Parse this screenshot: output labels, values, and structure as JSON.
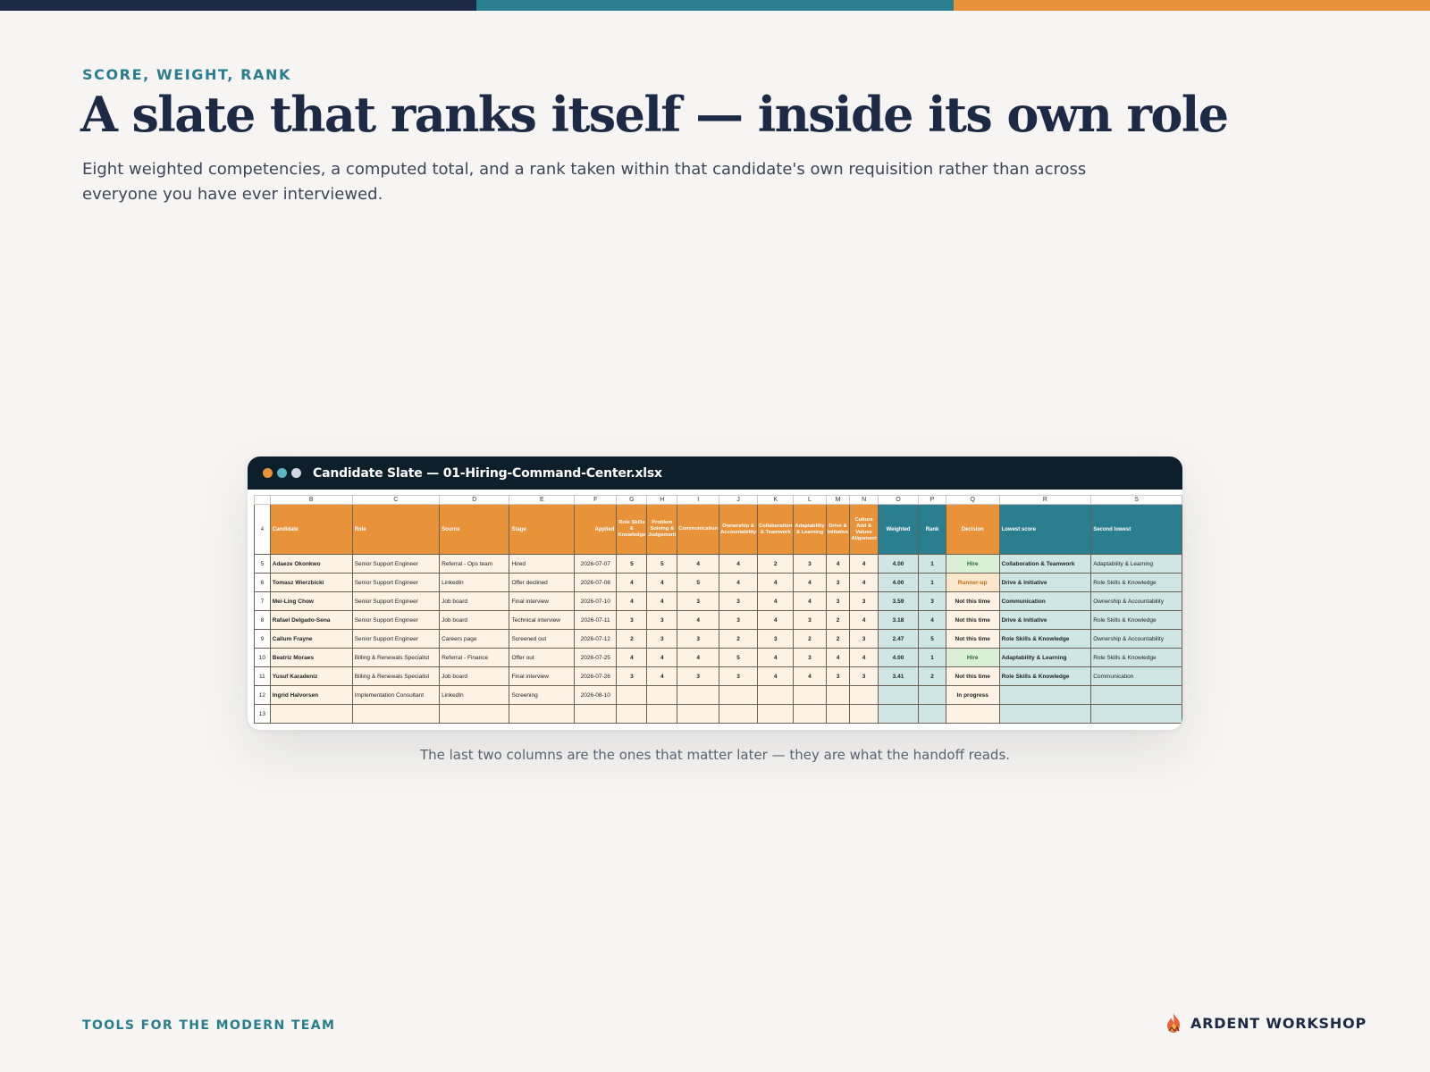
{
  "colors": {
    "navy": "#1c2a45",
    "teal": "#2a7f8e",
    "orange": "#e8923a"
  },
  "eyebrow": "SCORE, WEIGHT, RANK",
  "headline": "A slate that ranks itself — inside its own role",
  "subtitle": "Eight weighted competencies, a computed total, and a rank taken within that candidate's own requisition rather than across everyone you have ever interviewed.",
  "window": {
    "title": "Candidate Slate — 01-Hiring-Command-Center.xlsx",
    "dots": [
      "#e8923a",
      "#58b7c0",
      "#cfd6dd"
    ]
  },
  "sheet": {
    "column_letters": [
      "B",
      "C",
      "D",
      "E",
      "F",
      "G",
      "H",
      "I",
      "J",
      "K",
      "L",
      "M",
      "N",
      "O",
      "P",
      "Q",
      "R",
      "S"
    ],
    "header_row_number": "4",
    "headers": {
      "candidate": "Candidate",
      "role": "Role",
      "source": "Source",
      "stage": "Stage",
      "applied": "Applied",
      "competencies": [
        "Role Skills & Knowledge",
        "Problem Solving & Judgement",
        "Communication",
        "Ownership & Accountability",
        "Collaboration & Teamwork",
        "Adaptability & Learning",
        "Drive & Initiative",
        "Culture Add & Values Alignment"
      ],
      "weighted": "Weighted",
      "rank": "Rank",
      "decision": "Decision",
      "lowest": "Lowest score",
      "second": "Second lowest"
    },
    "rows": [
      {
        "n": "5",
        "candidate": "Adaeze Okonkwo",
        "role": "Senior Support Engineer",
        "source": "Referral - Ops team",
        "stage": "Hired",
        "applied": "2026-07-07",
        "scores": [
          "5",
          "5",
          "4",
          "4",
          "2",
          "3",
          "4",
          "4"
        ],
        "weighted": "4.00",
        "rank": "1",
        "decision": "Hire",
        "lowest": "Collaboration & Teamwork",
        "second": "Adaptability & Learning"
      },
      {
        "n": "6",
        "candidate": "Tomasz Wierzbicki",
        "role": "Senior Support Engineer",
        "source": "LinkedIn",
        "stage": "Offer declined",
        "applied": "2026-07-08",
        "scores": [
          "4",
          "4",
          "5",
          "4",
          "4",
          "4",
          "3",
          "4"
        ],
        "weighted": "4.00",
        "rank": "1",
        "decision": "Runner-up",
        "lowest": "Drive & Initiative",
        "second": "Role Skills & Knowledge"
      },
      {
        "n": "7",
        "candidate": "Mei-Ling Chow",
        "role": "Senior Support Engineer",
        "source": "Job board",
        "stage": "Final interview",
        "applied": "2026-07-10",
        "scores": [
          "4",
          "4",
          "3",
          "3",
          "4",
          "4",
          "3",
          "3"
        ],
        "weighted": "3.59",
        "rank": "3",
        "decision": "Not this time",
        "lowest": "Communication",
        "second": "Ownership & Accountability"
      },
      {
        "n": "8",
        "candidate": "Rafael Delgado-Sena",
        "role": "Senior Support Engineer",
        "source": "Job board",
        "stage": "Technical interview",
        "applied": "2026-07-11",
        "scores": [
          "3",
          "3",
          "4",
          "3",
          "4",
          "3",
          "2",
          "4"
        ],
        "weighted": "3.18",
        "rank": "4",
        "decision": "Not this time",
        "lowest": "Drive & Initiative",
        "second": "Role Skills & Knowledge"
      },
      {
        "n": "9",
        "candidate": "Callum Frayne",
        "role": "Senior Support Engineer",
        "source": "Careers page",
        "stage": "Screened out",
        "applied": "2026-07-12",
        "scores": [
          "2",
          "3",
          "3",
          "2",
          "3",
          "2",
          "2",
          "3"
        ],
        "weighted": "2.47",
        "rank": "5",
        "decision": "Not this time",
        "lowest": "Role Skills & Knowledge",
        "second": "Ownership & Accountability"
      },
      {
        "n": "10",
        "candidate": "Beatriz Moraes",
        "role": "Billing & Renewals Specialist",
        "source": "Referral - Finance",
        "stage": "Offer out",
        "applied": "2026-07-25",
        "scores": [
          "4",
          "4",
          "4",
          "5",
          "4",
          "3",
          "4",
          "4"
        ],
        "weighted": "4.00",
        "rank": "1",
        "decision": "Hire",
        "lowest": "Adaptability & Learning",
        "second": "Role Skills & Knowledge"
      },
      {
        "n": "11",
        "candidate": "Yusuf Karadeniz",
        "role": "Billing & Renewals Specialist",
        "source": "Job board",
        "stage": "Final interview",
        "applied": "2026-07-26",
        "scores": [
          "3",
          "4",
          "3",
          "3",
          "4",
          "4",
          "3",
          "3"
        ],
        "weighted": "3.41",
        "rank": "2",
        "decision": "Not this time",
        "lowest": "Role Skills & Knowledge",
        "second": "Communication"
      },
      {
        "n": "12",
        "candidate": "Ingrid Halvorsen",
        "role": "Implementation Consultant",
        "source": "LinkedIn",
        "stage": "Screening",
        "applied": "2026-08-10",
        "scores": [
          "",
          "",
          "",
          "",
          "",
          "",
          "",
          ""
        ],
        "weighted": "",
        "rank": "",
        "decision": "In progress",
        "lowest": "",
        "second": ""
      },
      {
        "n": "13",
        "candidate": "",
        "role": "",
        "source": "",
        "stage": "",
        "applied": "",
        "scores": [
          "",
          "",
          "",
          "",
          "",
          "",
          "",
          ""
        ],
        "weighted": "",
        "rank": "",
        "decision": "",
        "lowest": "",
        "second": ""
      }
    ]
  },
  "caption": "The last two columns are the ones that matter later — they are what the handoff reads.",
  "footer": {
    "tagline": "TOOLS FOR THE MODERN TEAM",
    "brand": "ARDENT WORKSHOP"
  }
}
